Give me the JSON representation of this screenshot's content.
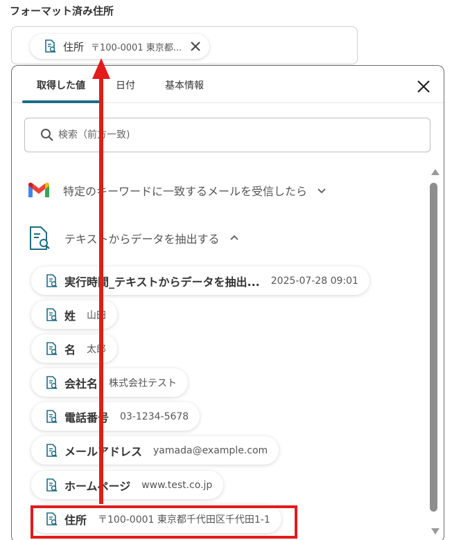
{
  "field": {
    "label": "フォーマット済み住所",
    "chip": {
      "name": "住所",
      "value": "〒100-0001 東京都..."
    }
  },
  "tabs": [
    "取得した値",
    "日付",
    "基本情報"
  ],
  "search": {
    "placeholder": "検索（前方一致)"
  },
  "sources": [
    {
      "label": "特定のキーワードに一致するメールを受信したら",
      "icon": "gmail-icon",
      "expanded": false
    },
    {
      "label": "テキストからデータを抽出する",
      "icon": "document-search-icon",
      "expanded": true
    }
  ],
  "values": [
    {
      "name": "実行時間_テキストからデータを抽出...",
      "value": "2025-07-28 09:01"
    },
    {
      "name": "姓",
      "value": "山田"
    },
    {
      "name": "名",
      "value": "太郎"
    },
    {
      "name": "会社名",
      "value": "株式会社テスト"
    },
    {
      "name": "電話番号",
      "value": "03-1234-5678"
    },
    {
      "name": "メールアドレス",
      "value": "yamada@example.com"
    },
    {
      "name": "ホームページ",
      "value": "www.test.co.jp"
    },
    {
      "name": "住所",
      "value": "〒100-0001 東京都千代田区千代田1-1"
    }
  ],
  "colors": {
    "accent": "#1b6b86",
    "annotation": "#e21b1b"
  }
}
